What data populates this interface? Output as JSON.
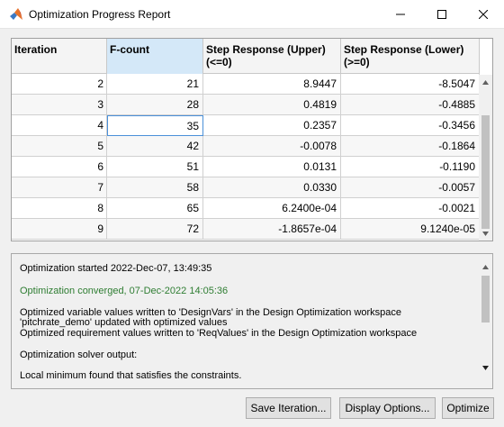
{
  "window": {
    "title": "Optimization Progress Report",
    "minimize_icon": "minimize-icon",
    "maximize_icon": "maximize-icon",
    "close_icon": "close-icon",
    "app_icon": "matlab-logo-icon"
  },
  "table": {
    "columns": [
      {
        "line1": "Iteration",
        "line2": ""
      },
      {
        "line1": "F-count",
        "line2": ""
      },
      {
        "line1": "Step Response (Upper)",
        "line2": "(<=0)"
      },
      {
        "line1": "Step Response (Lower)",
        "line2": "(>=0)"
      }
    ],
    "rows": [
      [
        "2",
        "21",
        "8.9447",
        "-8.5047"
      ],
      [
        "3",
        "28",
        "0.4819",
        "-0.4885"
      ],
      [
        "4",
        "35",
        "0.2357",
        "-0.3456"
      ],
      [
        "5",
        "42",
        "-0.0078",
        "-0.1864"
      ],
      [
        "6",
        "51",
        "0.0131",
        "-0.1190"
      ],
      [
        "7",
        "58",
        "0.0330",
        "-0.0057"
      ],
      [
        "8",
        "65",
        "6.2400e-04",
        "-0.0021"
      ],
      [
        "9",
        "72",
        "-1.8657e-04",
        "9.1240e-05"
      ]
    ]
  },
  "log": {
    "line1": "Optimization started 2022-Dec-07, 13:49:35",
    "line2": "Optimization converged, 07-Dec-2022 14:05:36",
    "line3": "Optimized variable values written to 'DesignVars' in the Design Optimization workspace",
    "line4": "'pitchrate_demo' updated with optimized values",
    "line5": "Optimized requirement values written to 'ReqValues' in the Design Optimization workspace",
    "line6": "Optimization solver output:",
    "line7": "Local minimum found that satisfies the constraints.",
    "converged_color": "#2e7d32"
  },
  "buttons": {
    "save": "Save Iteration...",
    "display": "Display Options...",
    "optimize": "Optimize"
  }
}
